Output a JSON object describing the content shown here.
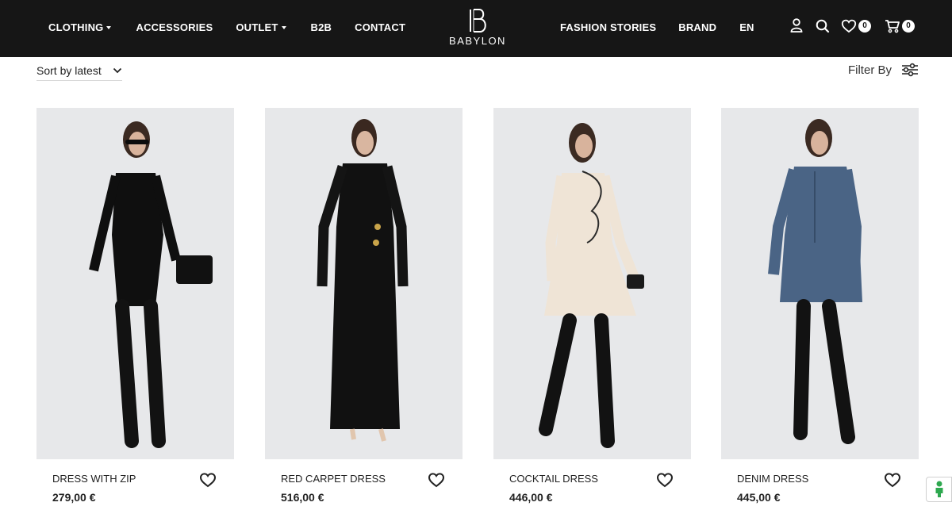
{
  "header": {
    "nav_left": [
      {
        "label": "CLOTHING",
        "dropdown": true
      },
      {
        "label": "ACCESSORIES",
        "dropdown": false
      },
      {
        "label": "OUTLET",
        "dropdown": true
      },
      {
        "label": "B2B",
        "dropdown": false
      },
      {
        "label": "CONTACT",
        "dropdown": false
      }
    ],
    "logo_text": "BABYLON",
    "nav_right": [
      {
        "label": "FASHION STORIES"
      },
      {
        "label": "BRAND"
      },
      {
        "label": "EN"
      }
    ],
    "icons": {
      "account": "user-icon",
      "search": "search-icon",
      "wishlist": "heart-icon",
      "cart": "cart-icon"
    },
    "wishlist_count": "0",
    "cart_count": "0",
    "colors": {
      "bar": "#161616",
      "text": "#ffffff"
    }
  },
  "toolbar": {
    "sort_label": "Sort by latest",
    "filter_label": "Filter By"
  },
  "products": [
    {
      "name": "DRESS WITH ZIP",
      "price": "279,00 €",
      "dress_color": "#0f0f0f"
    },
    {
      "name": "RED CARPET DRESS",
      "price": "516,00 €",
      "dress_color": "#111111"
    },
    {
      "name": "COCKTAIL DRESS",
      "price": "446,00 €",
      "dress_color": "#efe4d6"
    },
    {
      "name": "DENIM DRESS",
      "price": "445,00 €",
      "dress_color": "#4a6485"
    }
  ],
  "chat_widget": {
    "icon": "person-icon",
    "accent": "#2ea84f"
  }
}
